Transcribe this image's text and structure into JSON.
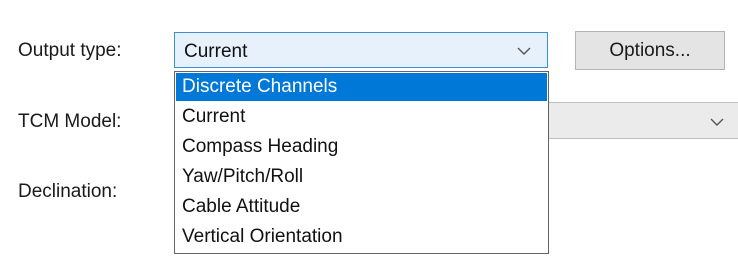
{
  "form": {
    "output_type_label": "Output type:",
    "output_type_value": "Current",
    "options_button": "Options...",
    "tcm_model_label": "TCM Model:",
    "declination_label": "Declination:"
  },
  "dropdown": {
    "options": [
      "Discrete Channels",
      "Current",
      "Compass Heading",
      "Yaw/Pitch/Roll",
      "Cable Attitude",
      "Vertical Orientation"
    ],
    "highlighted": "Discrete Channels"
  },
  "colors": {
    "highlight": "#0078d7",
    "focus_border": "#3c8fd6"
  }
}
